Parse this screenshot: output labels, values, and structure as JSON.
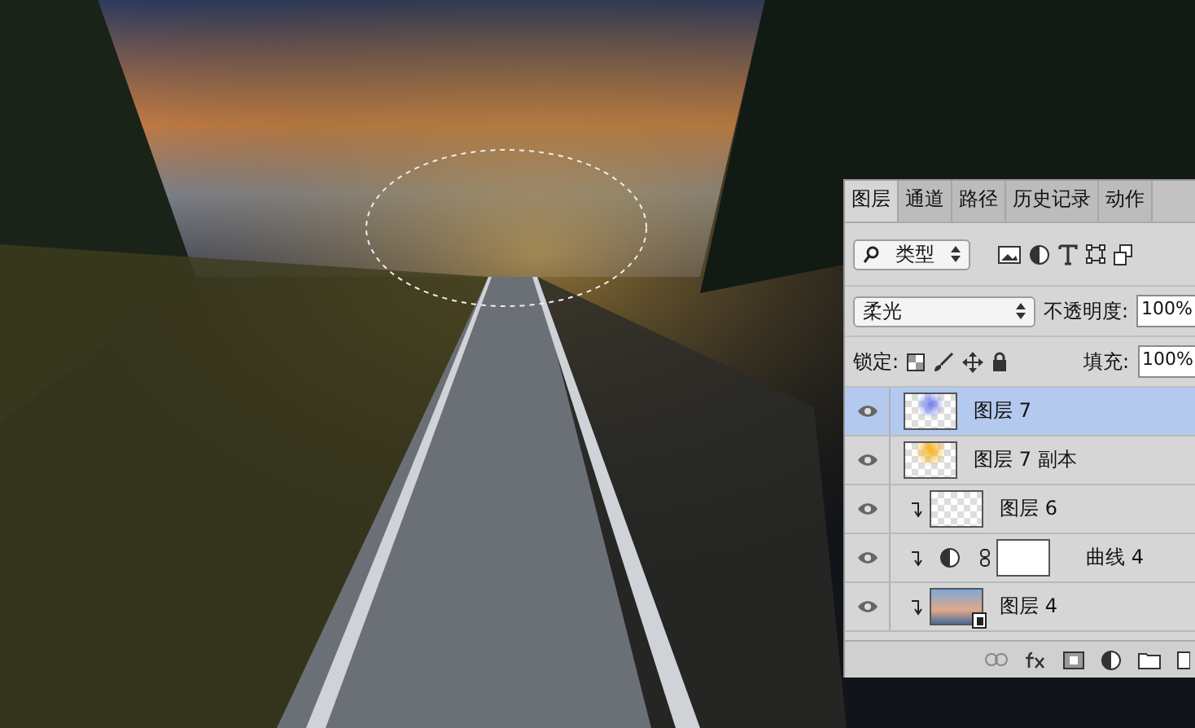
{
  "layers_panel": {
    "tabs": [
      {
        "label": "图层",
        "selected": true
      },
      {
        "label": "通道",
        "selected": false
      },
      {
        "label": "路径",
        "selected": false
      },
      {
        "label": "历史记录",
        "selected": false
      },
      {
        "label": "动作",
        "selected": false
      }
    ],
    "filter": {
      "value": "类型"
    },
    "blend_mode": {
      "value": "柔光"
    },
    "opacity": {
      "label": "不透明度:",
      "value": "100%"
    },
    "lock": {
      "label": "锁定:"
    },
    "fill": {
      "label": "填充:",
      "value": "100%"
    },
    "layers": [
      {
        "name": "图层 7",
        "kind": "pixel",
        "thumbnail": {
          "kind": "blue"
        },
        "selected": true,
        "clipped": false,
        "visible": true
      },
      {
        "name": "图层 7 副本",
        "kind": "pixel",
        "thumbnail": {
          "kind": "orange"
        },
        "selected": false,
        "clipped": false,
        "visible": true
      },
      {
        "name": "图层 6",
        "kind": "pixel",
        "thumbnail": {
          "kind": "empty"
        },
        "selected": false,
        "clipped": true,
        "visible": true
      },
      {
        "name": "曲线 4",
        "kind": "adjustment",
        "thumbnail": {
          "kind": "mask"
        },
        "selected": false,
        "clipped": true,
        "visible": true
      },
      {
        "name": "图层 4",
        "kind": "smart",
        "thumbnail": {
          "kind": "photo"
        },
        "selected": false,
        "clipped": true,
        "visible": true
      }
    ]
  }
}
